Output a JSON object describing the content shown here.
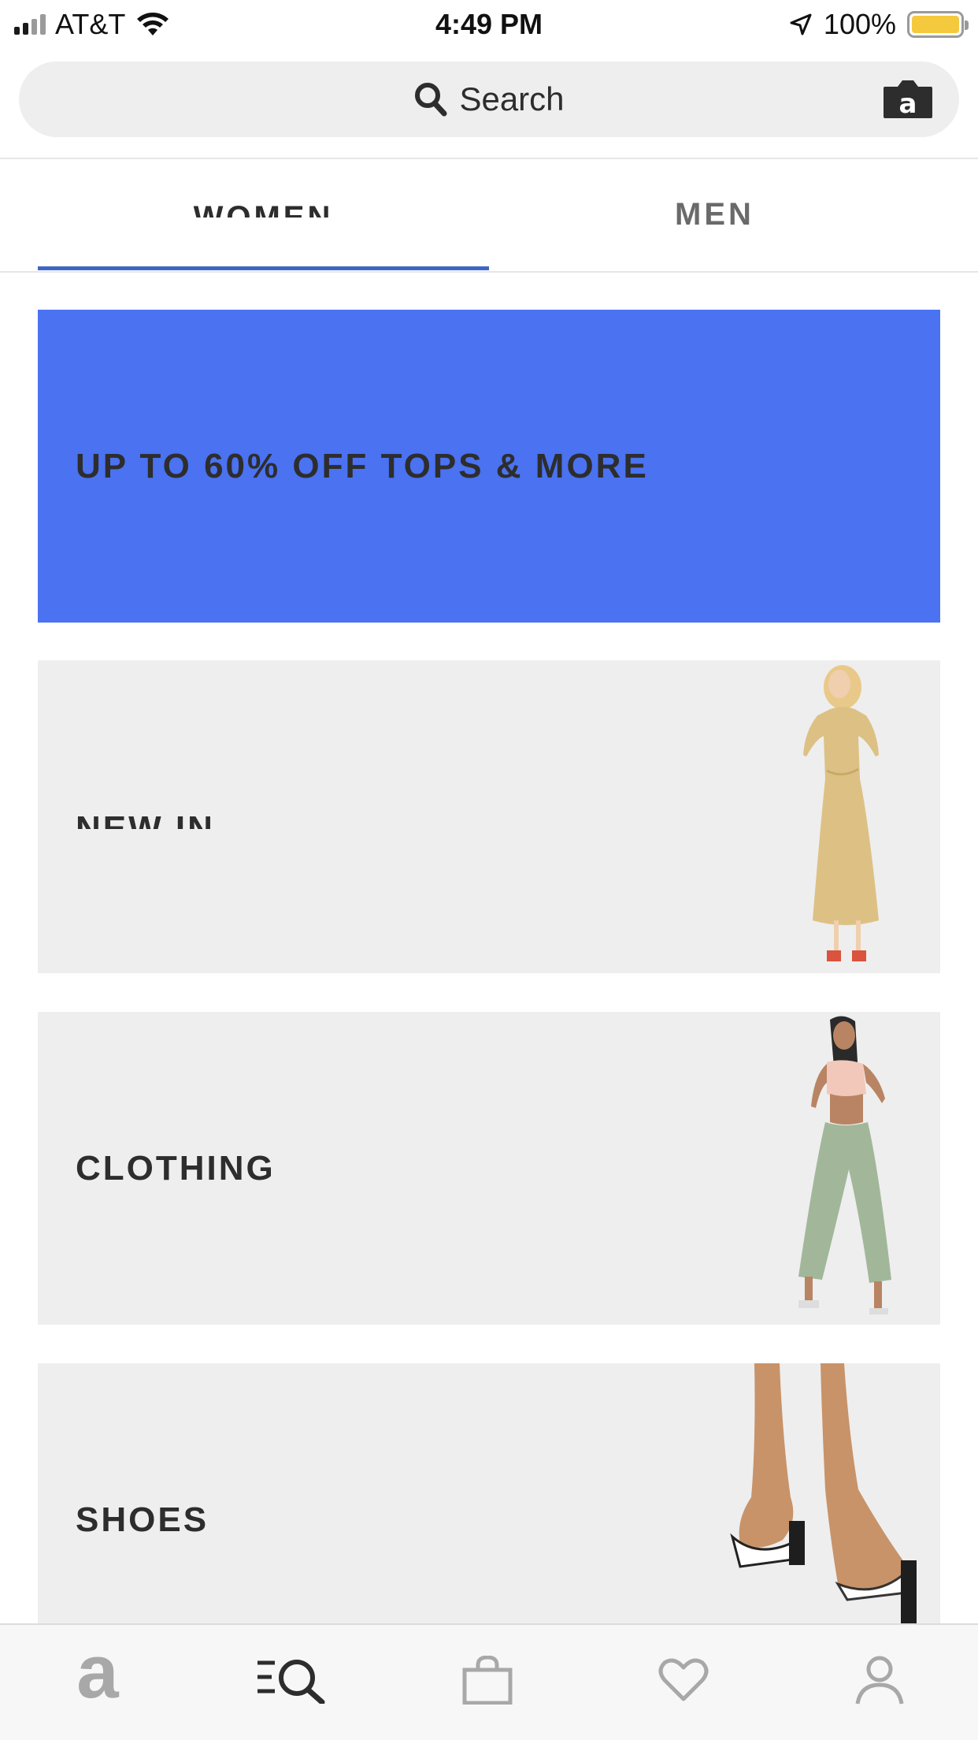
{
  "status_bar": {
    "carrier": "AT&T",
    "time": "4:49 PM",
    "battery_percent": "100%",
    "battery_level": 1.0,
    "battery_color": "#f5c93e"
  },
  "search": {
    "placeholder": "Search",
    "search_icon": "search-icon",
    "camera_icon": "camera-icon"
  },
  "tabs": {
    "items": [
      {
        "label": "WOMEN",
        "active": true
      },
      {
        "label": "MEN",
        "active": false
      }
    ],
    "accent_color": "#3e67c4"
  },
  "promo": {
    "text": "UP TO 60% OFF TOPS & MORE",
    "background": "#4a72f1"
  },
  "categories": [
    {
      "label": "NEW IN",
      "image": "model-yellow-wrap-dress"
    },
    {
      "label": "CLOTHING",
      "image": "model-green-joggers"
    },
    {
      "label": "SHOES",
      "image": "clear-block-heel-mules"
    }
  ],
  "bottom_nav": {
    "items": [
      {
        "name": "home",
        "icon": "brand-logo-icon",
        "glyph": "a"
      },
      {
        "name": "search",
        "icon": "search-menu-icon"
      },
      {
        "name": "bag",
        "icon": "shopping-bag-icon"
      },
      {
        "name": "saved",
        "icon": "heart-icon"
      },
      {
        "name": "account",
        "icon": "user-icon"
      }
    ]
  }
}
